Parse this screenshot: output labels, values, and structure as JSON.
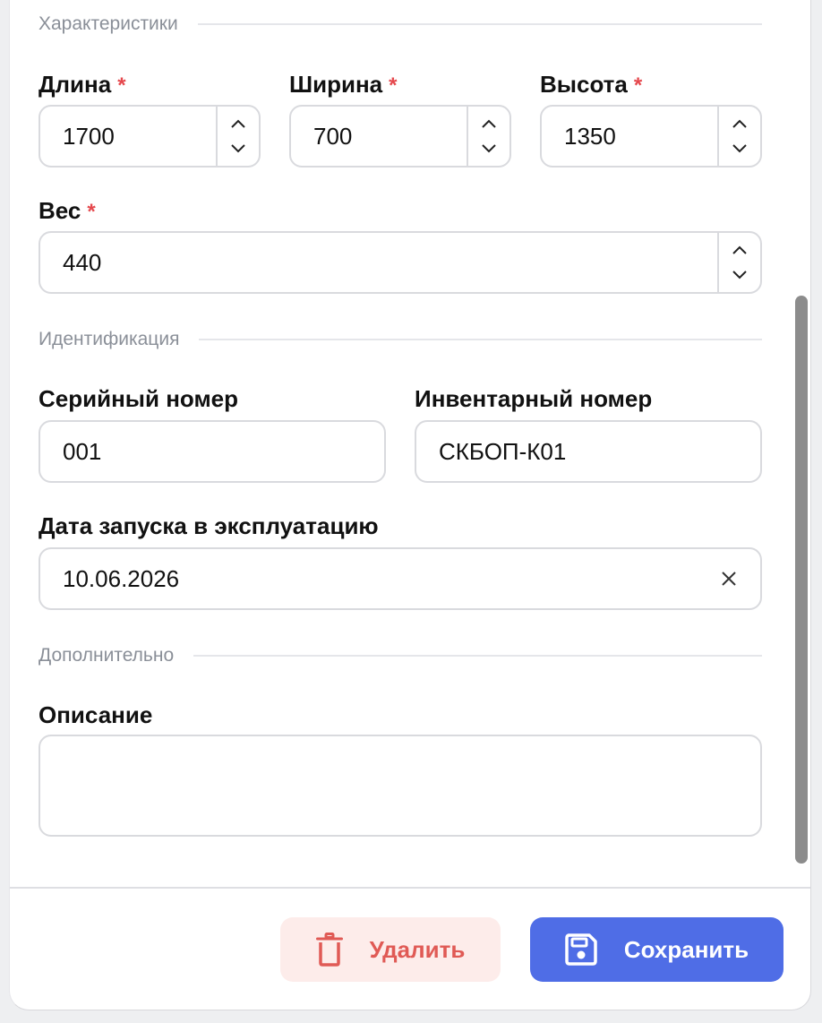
{
  "sections": {
    "characteristics": "Характеристики",
    "identification": "Идентификация",
    "additional": "Дополнительно"
  },
  "required_mark": "*",
  "fields": {
    "length": {
      "label": "Длина",
      "value": "1700"
    },
    "width": {
      "label": "Ширина",
      "value": "700"
    },
    "height": {
      "label": "Высота",
      "value": "1350"
    },
    "weight": {
      "label": "Вес",
      "value": "440"
    },
    "serial": {
      "label": "Серийный номер",
      "value": "001"
    },
    "inventory": {
      "label": "Инвентарный номер",
      "value": "СКБОП-К01"
    },
    "commission_date": {
      "label": "Дата запуска в эксплуатацию",
      "value": "10.06.2026"
    },
    "description": {
      "label": "Описание",
      "value": ""
    }
  },
  "buttons": {
    "delete": "Удалить",
    "save": "Сохранить"
  },
  "icons": {
    "stepper_up": "chevron-up-icon",
    "stepper_down": "chevron-down-icon",
    "clear": "close-icon",
    "delete": "trash-icon",
    "save": "floppy-disk-icon"
  },
  "colors": {
    "required": "#e5484d",
    "primary": "#4f6de6",
    "danger": "#e05a55",
    "danger_bg": "#fdecea"
  }
}
